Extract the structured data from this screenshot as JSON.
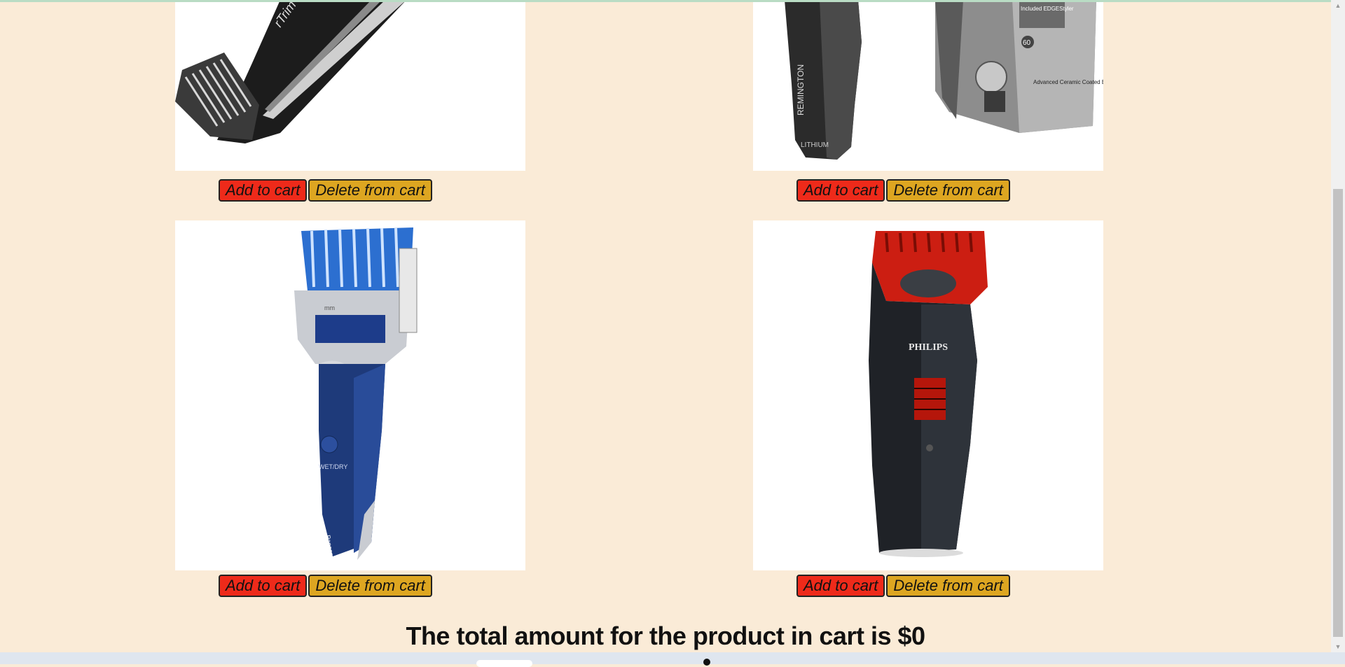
{
  "products": [
    {
      "name": "trimmer-1",
      "add_label": "Add to cart",
      "delete_label": "Delete from cart"
    },
    {
      "name": "trimmer-2",
      "add_label": "Add to cart",
      "delete_label": "Delete from cart"
    },
    {
      "name": "trimmer-3",
      "add_label": "Add to cart",
      "delete_label": "Delete from cart"
    },
    {
      "name": "trimmer-4",
      "add_label": "Add to cart",
      "delete_label": "Delete from cart"
    }
  ],
  "product_images": {
    "p1_text": "rTrim",
    "p2_brand": "REMINGTON",
    "p2_sub": "LITHIUM",
    "p2_box_text_1": "Included EDGEStyler",
    "p2_box_text_2": "Advanced Ceramic Coated Blades",
    "p2_box_num": "60",
    "p3_text_1": "WET/DRY",
    "p3_text_2": "Panasonic",
    "p3_text_3": "mm",
    "p4_brand": "PHILIPS"
  },
  "total_text": "The total amount for the product in cart is $0",
  "colors": {
    "background": "#faebd7",
    "add_button": "#ee2a1a",
    "delete_button": "#dda621"
  }
}
